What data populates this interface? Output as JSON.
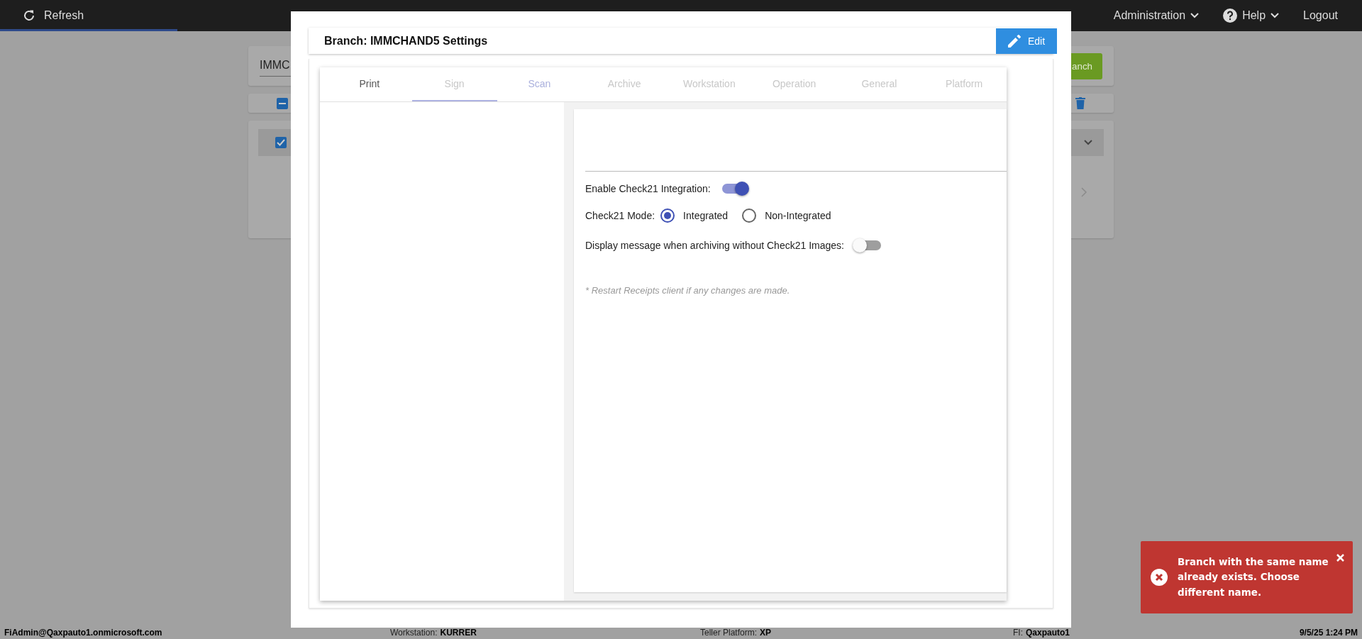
{
  "top_bar": {
    "refresh_label": "Refresh",
    "progress": {
      "level": 0.13
    },
    "menus": [
      {
        "kind": "admin",
        "label": "Administration"
      },
      {
        "kind": "help",
        "label": "Help"
      },
      {
        "kind": "logout",
        "label": "Logout"
      }
    ]
  },
  "background": {
    "branch_field_value": "IMMC",
    "add_button_label": "anch",
    "toolbar_checkbox_indeterminate": true,
    "row_checkbox_checked": true
  },
  "dialog": {
    "title": "Branch: IMMCHAND5 Settings",
    "edit_button": "Edit",
    "tabs": [
      {
        "label": "Print",
        "selected": false,
        "disabled": false,
        "highlighted": false
      },
      {
        "label": "Sign",
        "selected": true,
        "disabled": true,
        "highlighted": false
      },
      {
        "label": "Scan",
        "selected": false,
        "disabled": true,
        "highlighted": true
      },
      {
        "label": "Archive",
        "selected": false,
        "disabled": true,
        "highlighted": false
      },
      {
        "label": "Workstation",
        "selected": false,
        "disabled": true,
        "highlighted": false
      },
      {
        "label": "Operation",
        "selected": false,
        "disabled": true,
        "highlighted": false
      },
      {
        "label": "General",
        "selected": false,
        "disabled": true,
        "highlighted": false
      },
      {
        "label": "Platform",
        "selected": false,
        "disabled": true,
        "highlighted": false
      }
    ],
    "settings": [
      {
        "kind": "switch",
        "label": "Enable Check21 Integration:",
        "on": true
      },
      {
        "kind": "radio",
        "label": "Check21 Mode:",
        "options": [
          {
            "label": "Integrated",
            "selected": true
          },
          {
            "label": "Non-Integrated",
            "selected": false
          }
        ]
      },
      {
        "kind": "switch",
        "label": "Display message when archiving without Check21 Images:",
        "on": false
      }
    ],
    "note": "* Restart Receipts client if any changes are made."
  },
  "toast": {
    "message": "Branch with the same name already exists. Choose different name."
  },
  "status_bar": {
    "user": "FiAdmin@Qaxpauto1.onmicrosoft.com",
    "workstation": {
      "label": "Workstation:",
      "value": "KURRER"
    },
    "platform": {
      "label": "Teller Platform:",
      "value": "XP"
    },
    "fi": {
      "label": "FI:",
      "value": "Qaxpauto1"
    },
    "datetime": "9/5/25 1:24 PM"
  }
}
